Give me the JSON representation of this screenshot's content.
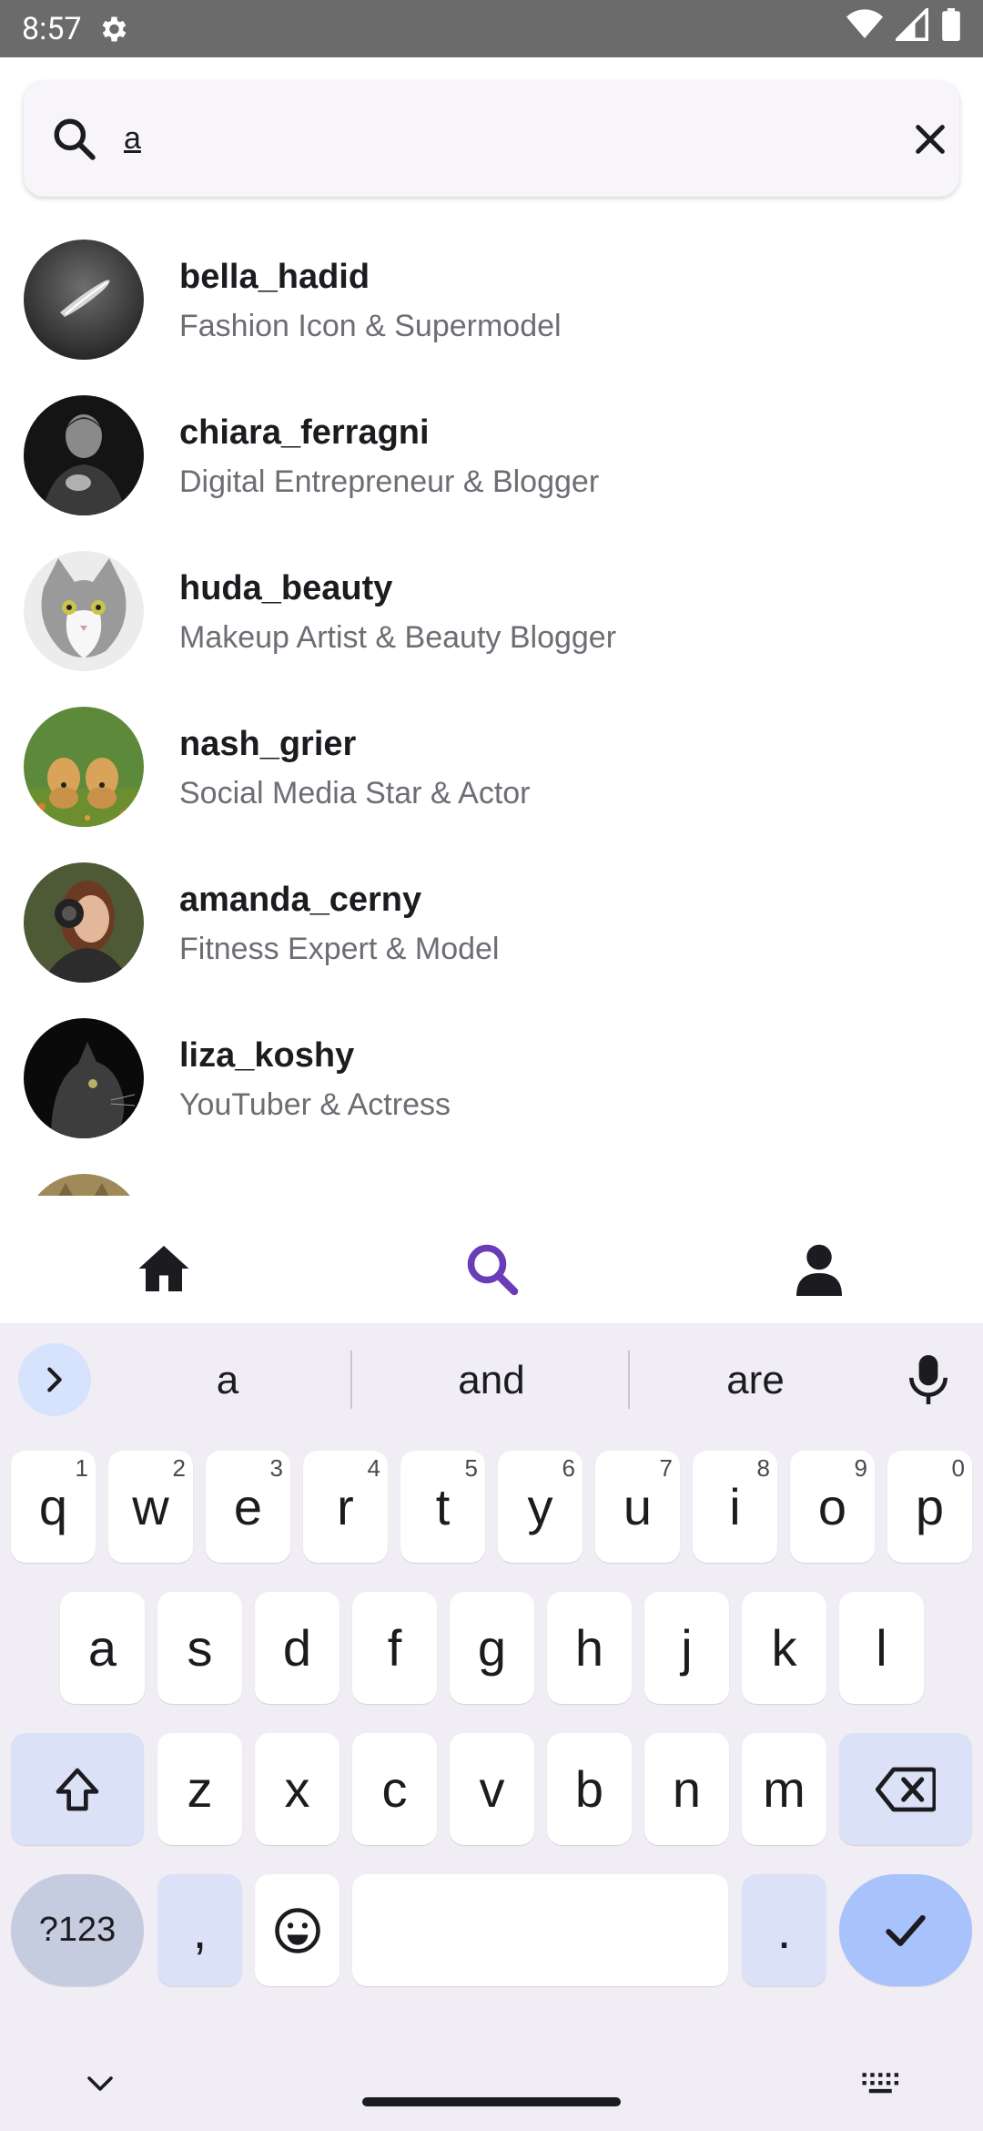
{
  "status_bar": {
    "time": "8:57",
    "icons": [
      "settings-gear-icon",
      "wifi-icon",
      "signal-icon",
      "battery-icon"
    ]
  },
  "search": {
    "value": "a",
    "placeholder": "",
    "clear_icon": "close-icon",
    "search_icon": "search-icon"
  },
  "results": [
    {
      "username": "bella_hadid",
      "bio": "Fashion Icon & Supermodel",
      "avatar": "dark-feather-photo"
    },
    {
      "username": "chiara_ferragni",
      "bio": "Digital Entrepreneur & Blogger",
      "avatar": "man-with-phone-photo"
    },
    {
      "username": "huda_beauty",
      "bio": "Makeup Artist & Beauty Blogger",
      "avatar": "cat-photo"
    },
    {
      "username": "nash_grier",
      "bio": "Social Media Star & Actor",
      "avatar": "puppies-photo"
    },
    {
      "username": "amanda_cerny",
      "bio": "Fitness Expert & Model",
      "avatar": "woman-camera-photo"
    },
    {
      "username": "liza_koshy",
      "bio": "YouTuber & Actress",
      "avatar": "black-cat-photo"
    }
  ],
  "bottom_nav": {
    "items": [
      {
        "name": "home",
        "icon": "home-icon",
        "active": false
      },
      {
        "name": "search",
        "icon": "search-icon",
        "active": true
      },
      {
        "name": "profile",
        "icon": "person-icon",
        "active": false
      }
    ],
    "active_color": "#6a3cb8"
  },
  "keyboard": {
    "suggestions": [
      "a",
      "and",
      "are"
    ],
    "row1": [
      {
        "key": "q",
        "hint": "1"
      },
      {
        "key": "w",
        "hint": "2"
      },
      {
        "key": "e",
        "hint": "3"
      },
      {
        "key": "r",
        "hint": "4"
      },
      {
        "key": "t",
        "hint": "5"
      },
      {
        "key": "y",
        "hint": "6"
      },
      {
        "key": "u",
        "hint": "7"
      },
      {
        "key": "i",
        "hint": "8"
      },
      {
        "key": "o",
        "hint": "9"
      },
      {
        "key": "p",
        "hint": "0"
      }
    ],
    "row2": [
      "a",
      "s",
      "d",
      "f",
      "g",
      "h",
      "j",
      "k",
      "l"
    ],
    "row3": [
      "z",
      "x",
      "c",
      "v",
      "b",
      "n",
      "m"
    ],
    "symbols_label": "?123",
    "comma": ",",
    "period": "."
  }
}
